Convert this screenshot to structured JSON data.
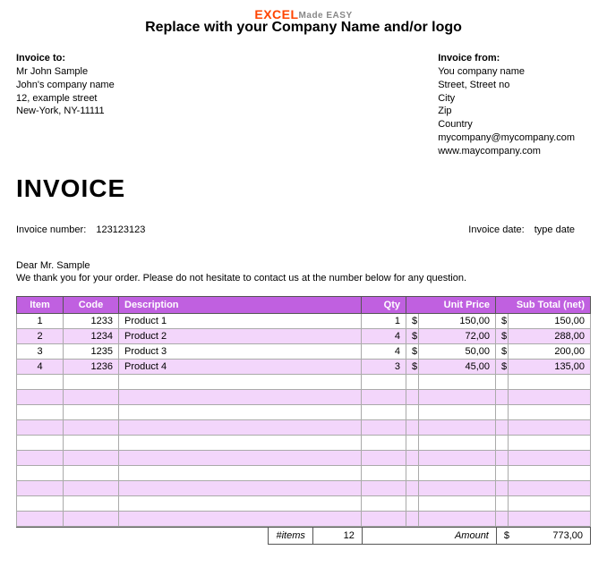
{
  "logo": {
    "excel": "EXCEL",
    "made": "Made EASY"
  },
  "company_line": "Replace with your Company Name  and/or logo",
  "invoice_to": {
    "title": "Invoice to:",
    "lines": [
      "Mr John Sample",
      "John's company name",
      "12, example street",
      "New-York, NY-11111"
    ]
  },
  "invoice_from": {
    "title": "Invoice from:",
    "lines": [
      "You company name",
      "Street, Street no",
      "City",
      "Zip",
      "Country",
      "mycompany@mycompany.com",
      "www.maycompany.com"
    ]
  },
  "invoice_title": "INVOICE",
  "meta": {
    "number_label": "Invoice number:",
    "number_value": "123123123",
    "date_label": "Invoice date:",
    "date_value": "type date"
  },
  "greeting": "Dear Mr. Sample",
  "thankyou": "We thank you for your order. Please do not hesitate to contact us at the number below for any question.",
  "columns": {
    "item": "Item",
    "code": "Code",
    "desc": "Description",
    "qty": "Qty",
    "unit": "Unit Price",
    "sub": "Sub Total (net)"
  },
  "currency": "$",
  "rows": [
    {
      "item": "1",
      "code": "1233",
      "desc": "Product 1",
      "qty": "1",
      "unit": "150,00",
      "sub": "150,00"
    },
    {
      "item": "2",
      "code": "1234",
      "desc": "Product 2",
      "qty": "4",
      "unit": "72,00",
      "sub": "288,00"
    },
    {
      "item": "3",
      "code": "1235",
      "desc": "Product 3",
      "qty": "4",
      "unit": "50,00",
      "sub": "200,00"
    },
    {
      "item": "4",
      "code": "1236",
      "desc": "Product 4",
      "qty": "3",
      "unit": "45,00",
      "sub": "135,00"
    }
  ],
  "empty_row_count": 10,
  "totals": {
    "items_label": "#items",
    "items_value": "12",
    "amount_label": "Amount",
    "amount_value": "773,00"
  }
}
